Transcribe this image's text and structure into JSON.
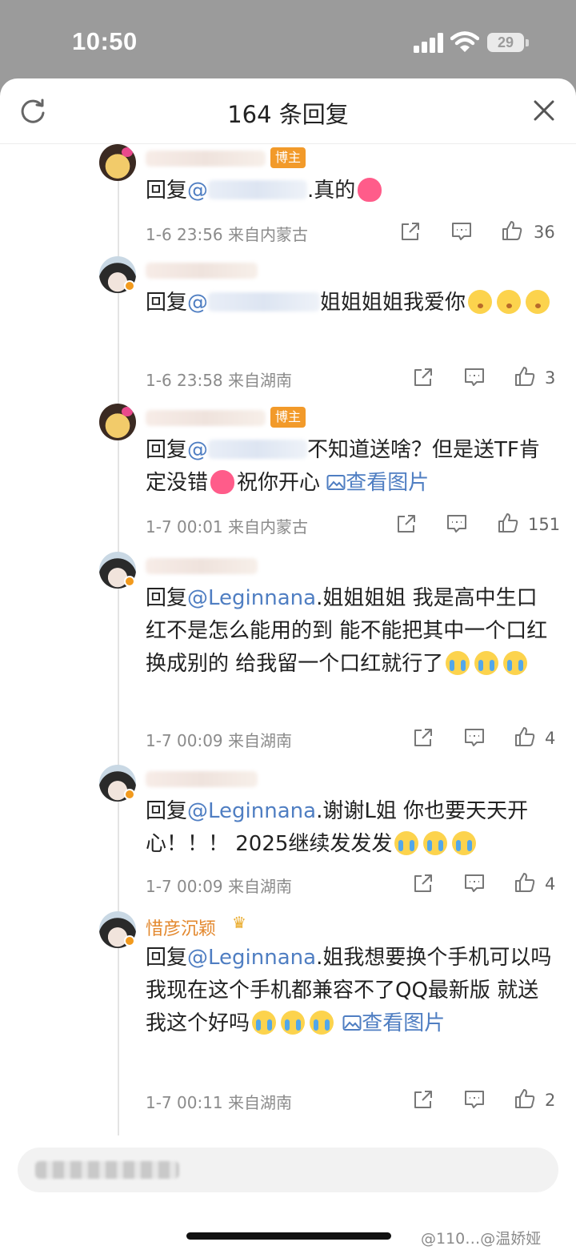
{
  "status_bar": {
    "time": "10:50",
    "battery": "29"
  },
  "header": {
    "title": "164 条回复"
  },
  "replies": [
    {
      "author_tag": "博主",
      "prefix": "回复",
      "mention": "@",
      "text": ".真的",
      "date": "1-6 23:56",
      "source": "来自内蒙古",
      "likes": "36"
    },
    {
      "prefix": "回复",
      "mention": "@",
      "text": "姐姐姐姐我爱你",
      "date": "1-6 23:58",
      "source": "来自湖南",
      "likes": "3"
    },
    {
      "author_tag": "博主",
      "prefix": "回复",
      "mention": "@",
      "text": "不知道送啥？但是送TF肯定没错",
      "text_after": "祝你开心",
      "link": "查看图片",
      "date": "1-7 00:01",
      "source": "来自内蒙古",
      "likes": "151"
    },
    {
      "prefix": "回复",
      "mention": "@Leginnana",
      "text": ".姐姐姐姐 我是高中生口红不是怎么能用的到 能不能把其中一个口红换成别的 给我留一个口红就行了",
      "date": "1-7 00:09",
      "source": "来自湖南",
      "likes": "4"
    },
    {
      "prefix": "回复",
      "mention": "@Leginnana",
      "text": ".谢谢L姐 你也要天天开心！！！ 2025继续发发发",
      "date": "1-7 00:09",
      "source": "来自湖南",
      "likes": "4"
    },
    {
      "author_name": "惜彦沉颖",
      "prefix": "回复",
      "mention": "@Leginnana",
      "text": ".姐我想要换个手机可以吗 我现在这个手机都兼容不了QQ最新版 就送我这个好吗",
      "link": "查看图片",
      "date": "1-7 00:11",
      "source": "来自湖南",
      "likes": "2"
    }
  ],
  "watermark": "@110…@温娇娅",
  "icons": {
    "refresh": "refresh-icon",
    "close": "close-icon",
    "share": "share-icon",
    "comment": "comment-icon",
    "like": "thumbs-up-icon",
    "verified": "verified-badge-icon",
    "image": "image-icon"
  },
  "colors": {
    "link": "#4f7ec2",
    "author_tag": "#f29a2a",
    "meta": "#8b8b8b"
  }
}
